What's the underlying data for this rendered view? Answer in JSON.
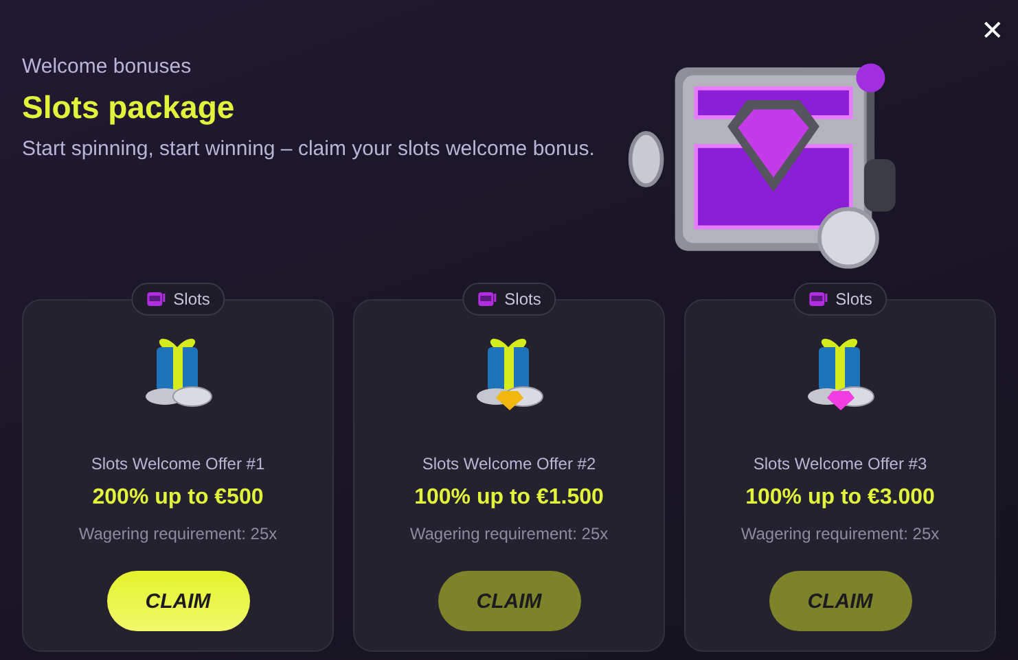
{
  "header": {
    "eyebrow": "Welcome bonuses",
    "title": "Slots package",
    "description": "Start spinning, start winning – claim your slots welcome bonus."
  },
  "close": {
    "glyph": "✕"
  },
  "offers": [
    {
      "tag": "Slots",
      "kind": "coins",
      "name": "Slots Welcome Offer #1",
      "amount": "200% up to €500",
      "wagering": "Wagering requirement: 25x",
      "button": "CLAIM",
      "selected": true
    },
    {
      "tag": "Slots",
      "kind": "gold-gem",
      "name": "Slots Welcome Offer #2",
      "amount": "100% up to €1.500",
      "wagering": "Wagering requirement: 25x",
      "button": "CLAIM",
      "selected": false
    },
    {
      "tag": "Slots",
      "kind": "pink-gem",
      "name": "Slots Welcome Offer #3",
      "amount": "100% up to €3.000",
      "wagering": "Wagering requirement: 25x",
      "button": "CLAIM",
      "selected": false
    }
  ]
}
